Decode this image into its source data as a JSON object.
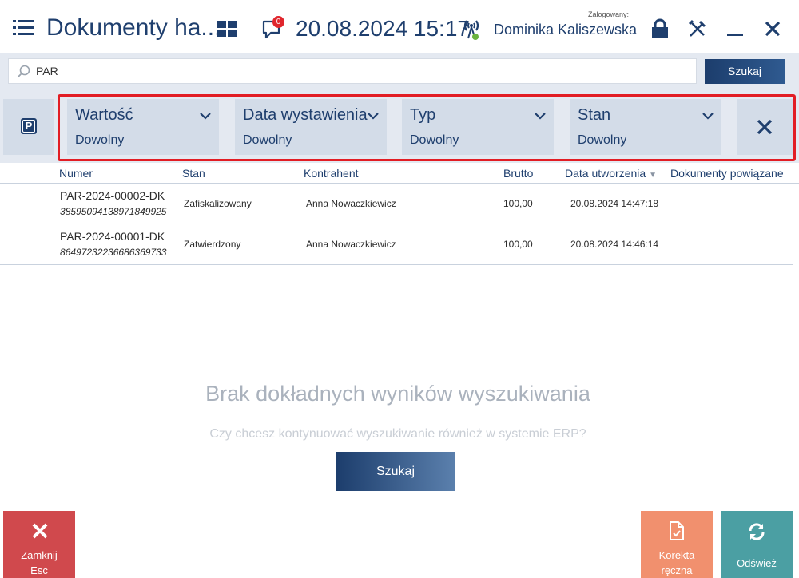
{
  "header": {
    "title": "Dokumenty ha...",
    "notification_count": "0",
    "datetime": "20.08.2024 15:17",
    "login_label": "Zalogowany:",
    "user_name": "Dominika Kaliszewska"
  },
  "search": {
    "value": "PAR",
    "button_label": "Szukaj"
  },
  "filters": [
    {
      "name": "Wartość",
      "value": "Dowolny"
    },
    {
      "name": "Data wystawienia",
      "value": "Dowolny"
    },
    {
      "name": "Typ",
      "value": "Dowolny"
    },
    {
      "name": "Stan",
      "value": "Dowolny"
    }
  ],
  "table": {
    "columns": [
      "Numer",
      "Stan",
      "Kontrahent",
      "Brutto",
      "Data utworzenia",
      "Dokumenty powiązane"
    ],
    "sort_indicator": "▼",
    "rows": [
      {
        "numer": "PAR-2024-00002-DK",
        "code": "38595094138971849925",
        "stan": "Zafiskalizowany",
        "kontrahent": "Anna Nowaczkiewicz",
        "brutto": "100,00",
        "data": "20.08.2024 14:47:18"
      },
      {
        "numer": "PAR-2024-00001-DK",
        "code": "86497232236686369733",
        "stan": "Zatwierdzony",
        "kontrahent": "Anna Nowaczkiewicz",
        "brutto": "100,00",
        "data": "20.08.2024 14:46:14"
      }
    ]
  },
  "empty_state": {
    "title": "Brak dokładnych wyników wyszukiwania",
    "subtitle": "Czy chcesz kontynuować wyszukiwanie również w systemie ERP?",
    "button_label": "Szukaj"
  },
  "footer": {
    "close_label": "Zamknij",
    "close_shortcut": "Esc",
    "correction_label_1": "Korekta",
    "correction_label_2": "ręczna",
    "refresh_label": "Odśwież"
  },
  "colors": {
    "brand": "#1f3f6e",
    "close_button": "#d0494d",
    "correction_button": "#f1906e",
    "refresh_button": "#4b9fa3",
    "highlight_frame": "#e21d24"
  },
  "icons": [
    "hamburger-icon",
    "tiles-icon",
    "notification-icon",
    "signal-icon",
    "lock-icon",
    "tools-icon",
    "minimize-icon",
    "close-icon",
    "search-icon",
    "parking-icon",
    "chevron-down-icon",
    "clear-filters-icon",
    "close-x-icon",
    "document-correction-icon",
    "refresh-icon"
  ]
}
